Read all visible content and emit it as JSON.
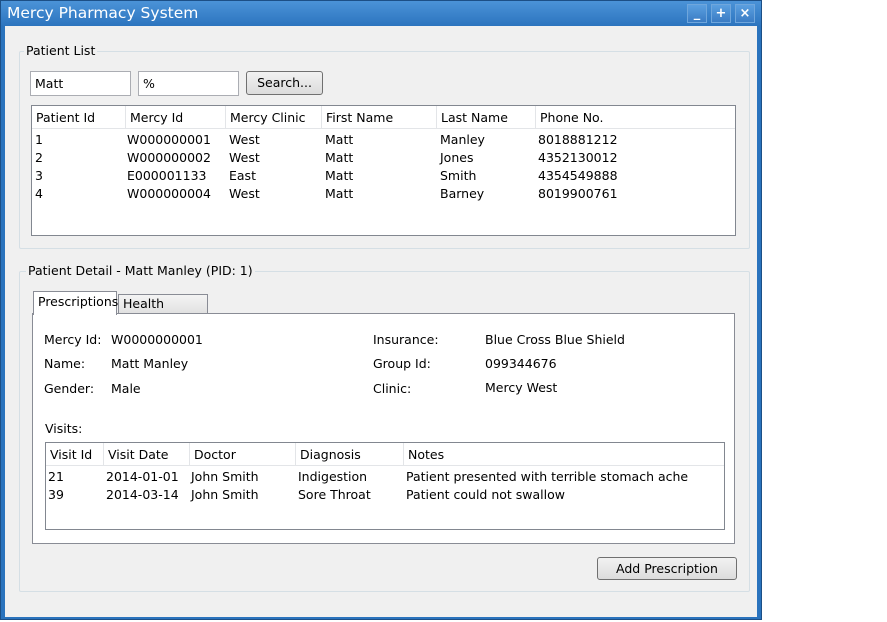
{
  "window": {
    "title": "Mercy Pharmacy System",
    "controls": [
      "_",
      "+",
      "×"
    ]
  },
  "patient_list": {
    "legend": "Patient List",
    "search_first": "Matt",
    "search_last": "%",
    "search_button": "Search...",
    "columns": [
      "Patient Id",
      "Mercy Id",
      "Mercy Clinic",
      "First Name",
      "Last Name",
      "Phone No."
    ],
    "rows": [
      [
        "1",
        "W000000001",
        "West",
        "Matt",
        "Manley",
        "8018881212"
      ],
      [
        "2",
        "W000000002",
        "West",
        "Matt",
        "Jones",
        "4352130012"
      ],
      [
        "3",
        "E000001133",
        "East",
        "Matt",
        "Smith",
        "4354549888"
      ],
      [
        "4",
        "W000000004",
        "West",
        "Matt",
        "Barney",
        "8019900761"
      ]
    ]
  },
  "patient_detail": {
    "legend": "Patient Detail - Matt Manley (PID: 1)",
    "tabs": [
      "Prescriptions",
      "Health Record"
    ],
    "fields": {
      "mercy_id_label": "Mercy Id:",
      "mercy_id": "W0000000001",
      "name_label": "Name:",
      "name": "Matt Manley",
      "gender_label": "Gender:",
      "gender": "Male",
      "insurance_label": "Insurance:",
      "insurance": "Blue Cross Blue Shield",
      "group_id_label": "Group Id:",
      "group_id": "099344676",
      "clinic_label": "Clinic:",
      "clinic": "Mercy West"
    },
    "visits_label": "Visits:",
    "visit_columns": [
      "Visit Id",
      "Visit Date",
      "Doctor",
      "Diagnosis",
      "Notes"
    ],
    "visits": [
      [
        "21",
        "2014-01-01",
        "John Smith",
        "Indigestion",
        "Patient presented with terrible stomach ache"
      ],
      [
        "39",
        "2014-03-14",
        "John Smith",
        "Sore Throat",
        "Patient could not swallow"
      ]
    ],
    "add_button": "Add Prescription"
  }
}
